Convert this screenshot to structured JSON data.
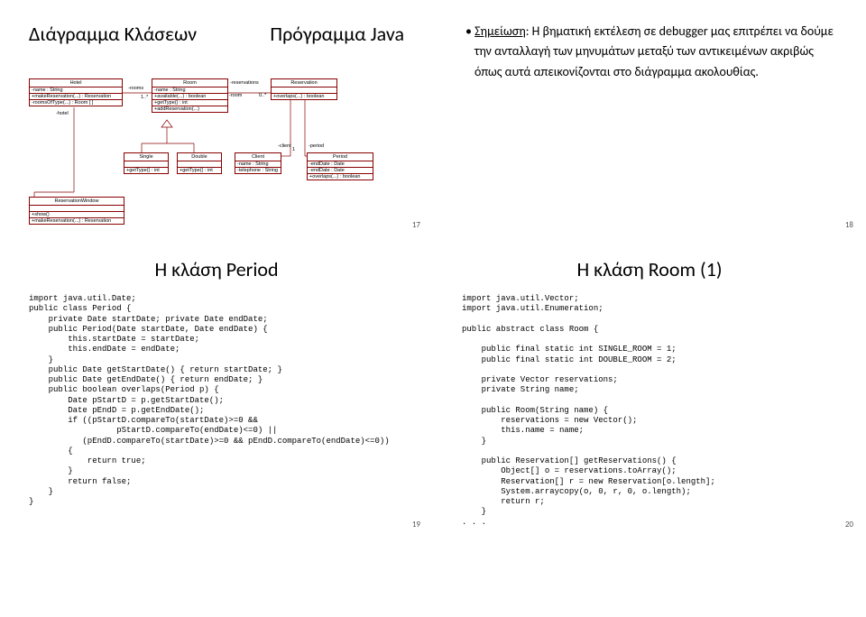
{
  "slide17": {
    "title_left": "Διάγραμμα Κλάσεων",
    "title_right": "Πρόγραμμα Java",
    "note_label": "Σημείωση",
    "note_body": ": Η βηματική εκτέλεση σε debugger μας επιτρέπει να δούμε την ανταλλαγή των μηνυμάτων μεταξύ των αντικειμένων ακριβώς όπως αυτά απεικονίζονται στο διάγραμμα ακολουθίας.",
    "pnum": "17",
    "uml": {
      "hotel_hd": "Hotel",
      "hotel_r1": "-name : String",
      "hotel_r2": "+makeReservation(...) : Reservation",
      "hotel_r3": "-roomsOfType(...) : Room [ ]",
      "room_hd": "Room",
      "room_r1": "-name : String",
      "room_r2": "+available(...) : boolean",
      "room_r3": "+getType() : int",
      "room_r4": "+addReservation(...)",
      "res_hd": "Reservation",
      "res_r1": "+overlaps(...) : boolean",
      "single_hd": "Single",
      "single_r1": "+getType() : int",
      "double_hd": "Double",
      "double_r1": "+getType() : int",
      "client_hd": "Client",
      "client_r1": "-name : String",
      "client_r2": "-telephone : String",
      "period_hd": "Period",
      "period_r1": "-endDate : Date",
      "period_r2": "-endDate : Date",
      "period_r3": "+overlaps(...) : boolean",
      "rw_hd": "ReservationWindow",
      "rw_r1": "+show()",
      "rw_r2": "+makeReservation(...) : Reservation",
      "l_rooms": "-rooms",
      "l_1s": "1..*",
      "l_reservations": "-reservations",
      "l_room": "-room",
      "l_0s": "0..*",
      "l_hotel": "-hotel",
      "l_client": "-client",
      "l_1": "1",
      "l_period": "-period"
    }
  },
  "slide18": {
    "pnum": "18"
  },
  "slide19": {
    "title": "Η κλάση Period",
    "pnum": "19",
    "code": "import java.util.Date;\npublic class Period {\n    private Date startDate; private Date endDate;\n    public Period(Date startDate, Date endDate) {\n        this.startDate = startDate;\n        this.endDate = endDate;\n    }\n    public Date getStartDate() { return startDate; }\n    public Date getEndDate() { return endDate; }\n    public boolean overlaps(Period p) {\n        Date pStartD = p.getStartDate();\n        Date pEndD = p.getEndDate();\n        if ((pStartD.compareTo(startDate)>=0 &&\n                  pStartD.compareTo(endDate)<=0) ||\n           (pEndD.compareTo(startDate)>=0 && pEndD.compareTo(endDate)<=0))\n        {\n            return true;\n        }\n        return false;\n    }\n}"
  },
  "slide20": {
    "title": "Η κλάση Room (1)",
    "pnum": "20",
    "code": "import java.util.Vector;\nimport java.util.Enumeration;\n\npublic abstract class Room {\n\n    public final static int SINGLE_ROOM = 1;\n    public final static int DOUBLE_ROOM = 2;\n\n    private Vector reservations;\n    private String name;\n\n    public Room(String name) {\n        reservations = new Vector();\n        this.name = name;\n    }\n\n    public Reservation[] getReservations() {\n        Object[] o = reservations.toArray();\n        Reservation[] r = new Reservation[o.length];\n        System.arraycopy(o, 0, r, 0, o.length);\n        return r;\n    }\n. . ."
  }
}
